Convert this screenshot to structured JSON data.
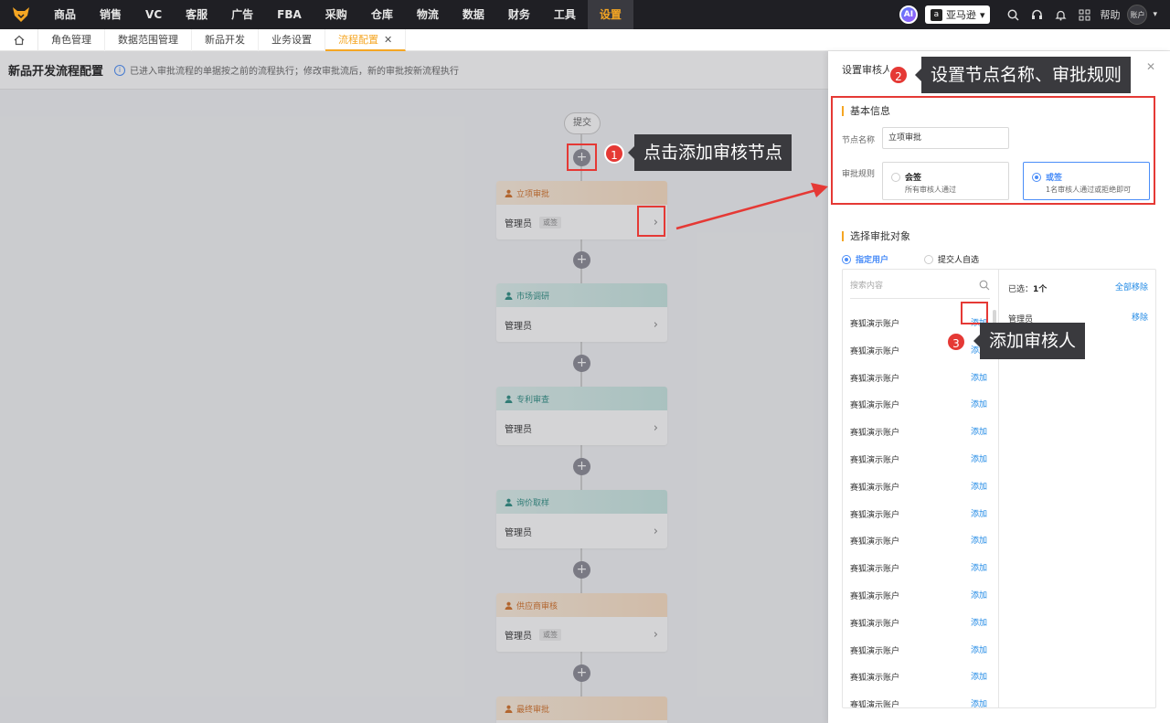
{
  "topnav": {
    "items": [
      "商品",
      "销售",
      "VC",
      "客服",
      "广告",
      "FBA",
      "采购",
      "仓库",
      "物流",
      "数据",
      "财务",
      "工具",
      "设置"
    ],
    "active_index": 12,
    "ai_label": "AI",
    "store": "亚马逊",
    "help": "帮助",
    "account": "账户"
  },
  "tabs": {
    "items": [
      "角色管理",
      "数据范围管理",
      "新品开发",
      "业务设置",
      "流程配置"
    ],
    "close": "✕"
  },
  "page": {
    "title": "新品开发流程配置",
    "tip": "已进入审批流程的单据按之前的流程执行；修改审批流后，新的审批按新流程执行"
  },
  "flow": {
    "submit": "提交",
    "nodes": [
      {
        "title": "立项审批",
        "user": "管理员",
        "tag": "或签",
        "color": "orange"
      },
      {
        "title": "市场调研",
        "user": "管理员",
        "tag": "",
        "color": "teal"
      },
      {
        "title": "专利审查",
        "user": "管理员",
        "tag": "",
        "color": "teal"
      },
      {
        "title": "询价取样",
        "user": "管理员",
        "tag": "",
        "color": "teal"
      },
      {
        "title": "供应商审核",
        "user": "管理员",
        "tag": "或签",
        "color": "orange"
      },
      {
        "title": "最终审批",
        "user": "",
        "tag": "",
        "color": "orange"
      }
    ]
  },
  "drawer": {
    "title": "设置审核人",
    "basic_section": "基本信息",
    "node_name_label": "节点名称",
    "node_name_value": "立项审批",
    "rule_label": "审批规则",
    "rules": [
      {
        "title": "会签",
        "desc": "所有审核人通过"
      },
      {
        "title": "或签",
        "desc": "1名审核人通过或拒绝即可"
      }
    ],
    "target_section": "选择审批对象",
    "target_options": [
      "指定用户",
      "提交人自选"
    ],
    "search_placeholder": "搜索内容",
    "user_name": "赛狐演示账户",
    "add_label": "添加",
    "selected_label": "已选：",
    "selected_count": "1个",
    "remove_all": "全部移除",
    "selected_user": "管理员",
    "remove": "移除"
  },
  "annotations": {
    "step1": {
      "num": "1",
      "text": "点击添加审核节点"
    },
    "step2": {
      "num": "2",
      "text": "设置节点名称、审批规则"
    },
    "step3": {
      "num": "3",
      "text": "添加审核人"
    }
  },
  "colors": {
    "accent": "#f5a623",
    "link": "#1e88e5",
    "annotation": "#e53935"
  }
}
